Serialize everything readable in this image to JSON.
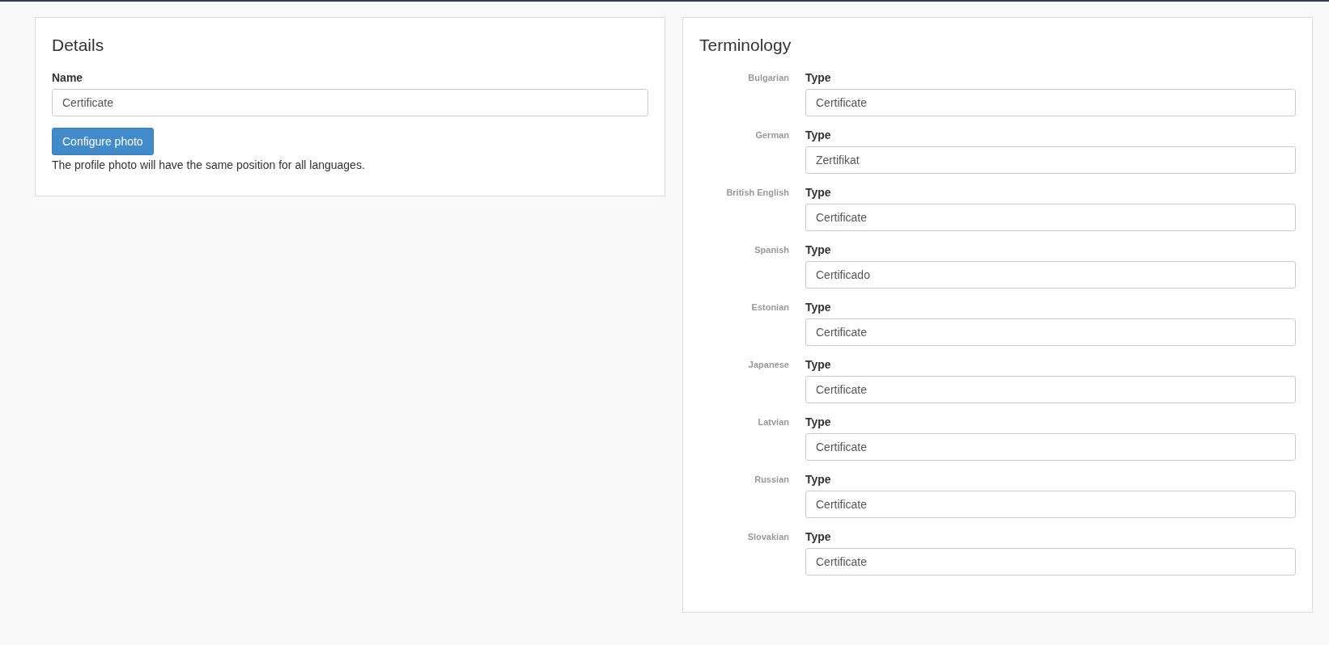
{
  "details": {
    "title": "Details",
    "name_label": "Name",
    "name_value": "Certificate",
    "button": "Configure photo",
    "note": "The profile photo will have the same position for all languages."
  },
  "terminology": {
    "title": "Terminology",
    "rows": [
      {
        "language": "Bulgarian",
        "label": "Type",
        "value": "Certificate"
      },
      {
        "language": "German",
        "label": "Type",
        "value": "Zertifikat"
      },
      {
        "language": "British English",
        "label": "Type",
        "value": "Certificate"
      },
      {
        "language": "Spanish",
        "label": "Type",
        "value": "Certificado"
      },
      {
        "language": "Estonian",
        "label": "Type",
        "value": "Certificate"
      },
      {
        "language": "Japanese",
        "label": "Type",
        "value": "Certificate"
      },
      {
        "language": "Latvian",
        "label": "Type",
        "value": "Certificate"
      },
      {
        "language": "Russian",
        "label": "Type",
        "value": "Certificate"
      },
      {
        "language": "Slovakian",
        "label": "Type",
        "value": "Certificate"
      }
    ]
  }
}
